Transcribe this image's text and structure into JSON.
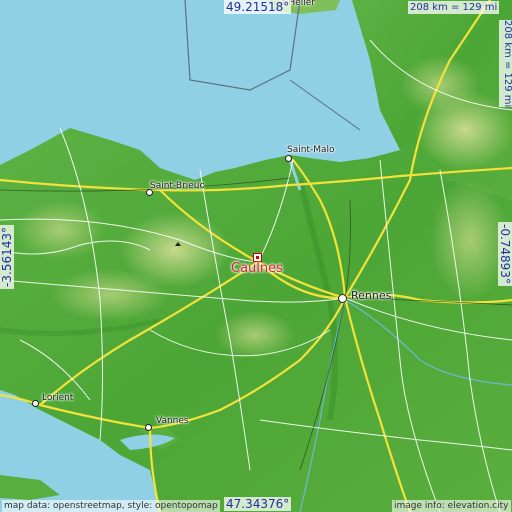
{
  "map": {
    "target": {
      "name": "Caulnes"
    },
    "cities": [
      {
        "id": "rennes",
        "name": "Rennes"
      },
      {
        "id": "saint-malo",
        "name": "Saint-Malo"
      },
      {
        "id": "saint-brieuc",
        "name": "Saint-Brieuc"
      },
      {
        "id": "lorient",
        "name": "Lorient"
      },
      {
        "id": "vannes",
        "name": "Vannes"
      },
      {
        "id": "saint-helier",
        "name": "t Helier"
      }
    ],
    "coords": {
      "top": "49.21518°",
      "bottom": "47.34376°",
      "left": "-3.56143°",
      "right": "-0.74893°"
    },
    "scale_horizontal": "208 km = 129 mi",
    "scale_vertical": "208 km = 129 mi",
    "credit_left": "map data: openstreetmap, style: opentopomap",
    "credit_right": "image info: elevation.city",
    "colors": {
      "sea": "#8fd0e4",
      "lowland": "#4faa3a",
      "highland": "#b8d488",
      "road_major": "#f2e23a",
      "road_minor": "#ffffff",
      "marker": "#e0202a",
      "coord_text": "#2430a0"
    }
  }
}
